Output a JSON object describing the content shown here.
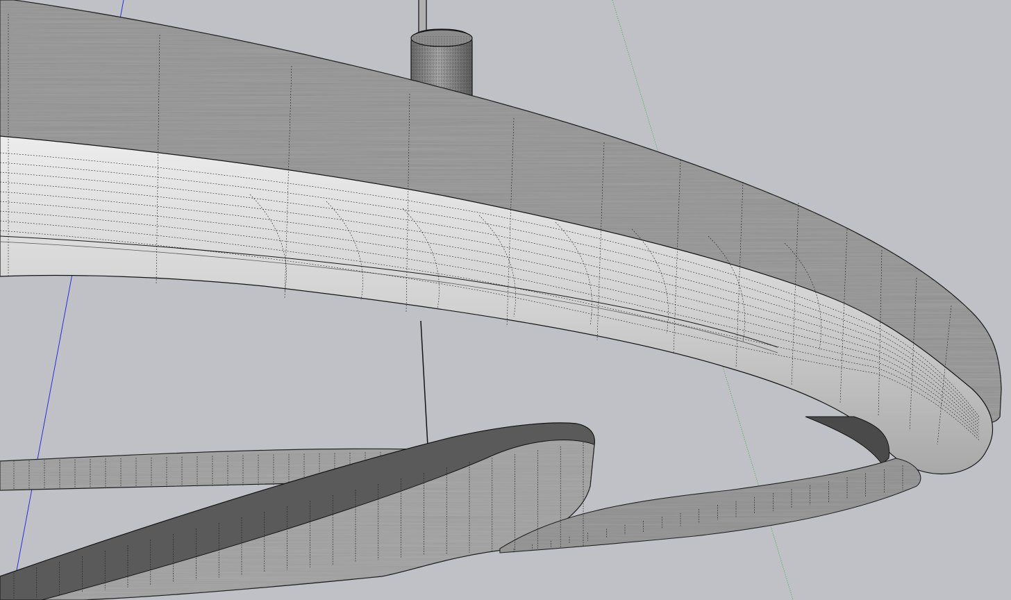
{
  "viewport": {
    "background_color": "#bfc1c6",
    "render_style": "textured-with-hidden-geometry-edges",
    "axes": [
      {
        "name": "blue-axis",
        "color": "#2828d8"
      },
      {
        "name": "green-axis",
        "color": "#3fae3f"
      }
    ]
  },
  "model": {
    "description_icon": "suspended-ring-chandelier-icon",
    "materials": {
      "brushed_metal_light": "#9c9c9c",
      "brushed_metal_dark": "#5a5a5a",
      "inner_surface": "#d4d4d4",
      "edge_line": "#141414",
      "hidden_edge": "#2a2a2a"
    },
    "parts": [
      {
        "name": "upper-ring"
      },
      {
        "name": "lower-ring-front"
      },
      {
        "name": "lower-ring-back"
      },
      {
        "name": "ceiling-canopy"
      },
      {
        "name": "suspension-cable-upper"
      },
      {
        "name": "suspension-cable-lower"
      }
    ]
  }
}
